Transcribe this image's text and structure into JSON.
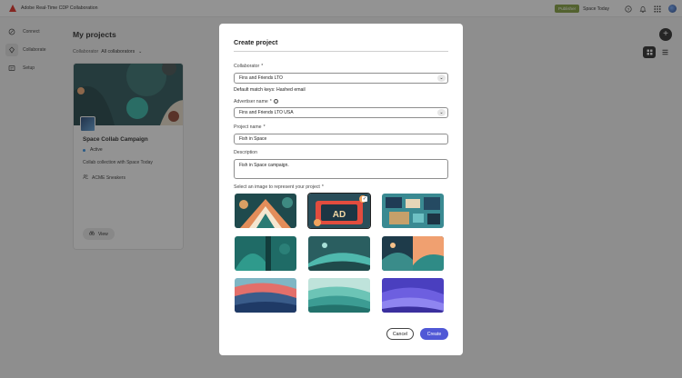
{
  "app": {
    "title": "Adobe Real-Time CDP Collaboration",
    "role_badge": "Publisher",
    "org_name": "Space Today"
  },
  "sidebar": {
    "items": [
      {
        "label": "Connect",
        "icon": "connect-icon"
      },
      {
        "label": "Collaborate",
        "icon": "collaborate-icon",
        "active": true
      },
      {
        "label": "Setup",
        "icon": "setup-icon"
      }
    ],
    "collapse": "«"
  },
  "main": {
    "title": "My projects",
    "filter_label": "Collaborator",
    "filter_value": "All collaborators",
    "card": {
      "title": "Space Collab Campaign",
      "status": "Active",
      "description": "Collab collection with Space Today",
      "partner": "ACME Sneakers",
      "view_label": "View"
    }
  },
  "modal": {
    "title": "Create project",
    "collaborator_label": "Collaborator",
    "collaborator_value": "Fins and Friends LTO",
    "match_keys": "Default match keys: Hashed email",
    "advertiser_label": "Advertiser name",
    "advertiser_value": "Fins and Friends LTO USA",
    "project_name_label": "Project name",
    "project_name_value": "Fish in Space",
    "description_label": "Description",
    "description_value": "Fish in Space campaign.",
    "image_label": "Select an image to represent your project",
    "required_mark": "*",
    "selected_image_index": 1,
    "cancel_label": "Cancel",
    "create_label": "Create"
  },
  "colors": {
    "primary_button": "#5058d6",
    "status_active": "#2d8fe6",
    "badge": "#7e9d36"
  }
}
